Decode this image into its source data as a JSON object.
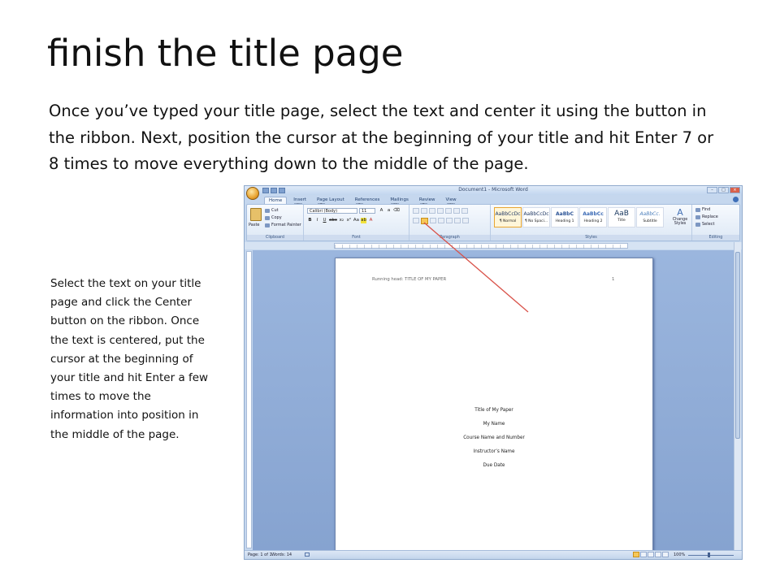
{
  "slide": {
    "title": "finish the title page",
    "intro": "Once you’ve typed your title page, select the text and center it using the button in the ribbon. Next, position the cursor at the beginning of your title and hit Enter 7 or 8 times to move everything down to the middle of the page.",
    "side_note": "Select the text on your title page and click the Center button on the ribbon. Once the text is centered, put the cursor at the beginning of your title and hit Enter a few times to move the information into position in the middle of the page."
  },
  "word": {
    "window_title": "Document1 - Microsoft Word",
    "tabs": [
      {
        "label": "Home",
        "keytip": "H"
      },
      {
        "label": "Insert",
        "keytip": "N"
      },
      {
        "label": "Page Layout",
        "keytip": "P"
      },
      {
        "label": "References",
        "keytip": "S"
      },
      {
        "label": "Mailings",
        "keytip": "M"
      },
      {
        "label": "Review",
        "keytip": "R"
      },
      {
        "label": "View",
        "keytip": "W"
      }
    ],
    "qat_keytips": [
      "1",
      "2",
      "3"
    ],
    "clipboard": {
      "paste": "Paste",
      "cut": "Cut",
      "copy": "Copy",
      "format_painter": "Format Painter",
      "label": "Clipboard"
    },
    "font": {
      "name": "Calibri (Body)",
      "size": "11",
      "label": "Font"
    },
    "paragraph": {
      "label": "Paragraph"
    },
    "styles": {
      "label": "Styles",
      "items": [
        {
          "sample": "AaBbCcDc",
          "name": "¶ Normal"
        },
        {
          "sample": "AaBbCcDc",
          "name": "¶ No Spaci..."
        },
        {
          "sample": "AaBbC",
          "name": "Heading 1"
        },
        {
          "sample": "AaBbCc",
          "name": "Heading 2"
        },
        {
          "sample": "AaB",
          "name": "Title"
        },
        {
          "sample": "AaBbCc.",
          "name": "Subtitle"
        }
      ],
      "change_styles": "Change Styles"
    },
    "editing": {
      "find": "Find",
      "replace": "Replace",
      "select": "Select",
      "label": "Editing"
    },
    "document": {
      "running_head": "Running head: TITLE OF MY PAPER",
      "page_number": "1",
      "title_lines": [
        "Title of My Paper",
        "My Name",
        "Course Name and Number",
        "Instructor’s Name",
        "Due Date"
      ]
    },
    "status": {
      "page": "Page: 1 of 1",
      "words": "Words: 14",
      "zoom": "100%"
    }
  },
  "colors": {
    "annotation_arrow": "#d9534a",
    "canvas": "#8fabd6",
    "ribbon": "#dde8f5"
  }
}
